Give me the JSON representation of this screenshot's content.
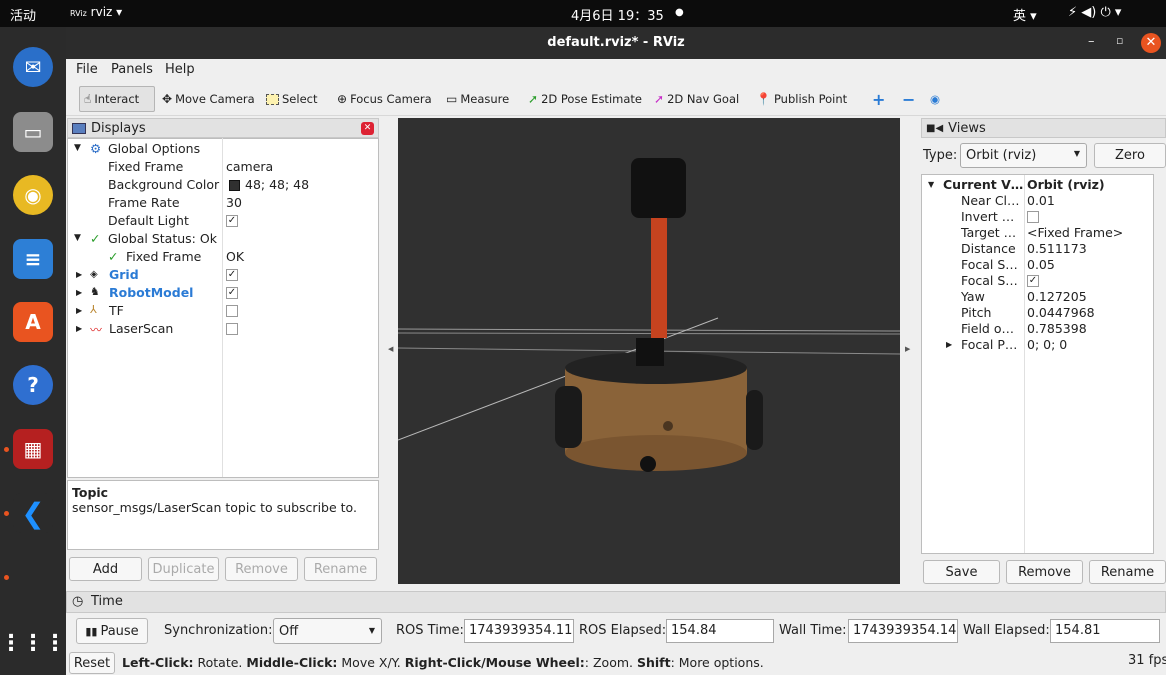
{
  "topbar": {
    "activities": "活动",
    "app": "rviz ▾",
    "clock": "4月6日 19：35",
    "clock_dot": "●",
    "ime": "英 ▾",
    "tray": "⚡ ◀) ⏻ ▾"
  },
  "window": {
    "title": "default.rviz* - RViz"
  },
  "menu": [
    "File",
    "Panels",
    "Help"
  ],
  "toolbar": {
    "interact": "Interact",
    "move_camera": "Move Camera",
    "select": "Select",
    "focus_camera": "Focus Camera",
    "measure": "Measure",
    "pose_estimate": "2D Pose Estimate",
    "nav_goal": "2D Nav Goal",
    "publish_point": "Publish Point",
    "plus": "+",
    "minus": "−",
    "eye": "◉"
  },
  "displays": {
    "title": "Displays",
    "rows": [
      {
        "name": "Global Options",
        "value": ""
      },
      {
        "name": "Fixed Frame",
        "value": "camera"
      },
      {
        "name": "Background Color",
        "value": "48; 48; 48"
      },
      {
        "name": "Frame Rate",
        "value": "30"
      },
      {
        "name": "Default Light",
        "value": "✓"
      },
      {
        "name": "Global Status: Ok",
        "value": ""
      },
      {
        "name": "Fixed Frame",
        "value": "OK"
      },
      {
        "name": "Grid",
        "value": "✓"
      },
      {
        "name": "RobotModel",
        "value": "✓"
      },
      {
        "name": "TF",
        "value": ""
      },
      {
        "name": "LaserScan",
        "value": ""
      }
    ],
    "colors": {
      "grid": "#2b7bd5",
      "robotmodel": "#2b7bd5",
      "bg_swatch": "#303030"
    }
  },
  "topic": {
    "heading": "Topic",
    "description": "sensor_msgs/LaserScan topic to subscribe to."
  },
  "display_buttons": {
    "add": "Add",
    "duplicate": "Duplicate",
    "remove": "Remove",
    "rename": "Rename"
  },
  "views": {
    "title": "Views",
    "type_label": "Type:",
    "type_value": "Orbit (rviz)",
    "zero": "Zero",
    "rows": [
      {
        "name": "Current V…",
        "value": "Orbit (rviz)"
      },
      {
        "name": "Near Cl…",
        "value": "0.01"
      },
      {
        "name": "Invert …",
        "value": ""
      },
      {
        "name": "Target …",
        "value": "<Fixed Frame>"
      },
      {
        "name": "Distance",
        "value": "0.511173"
      },
      {
        "name": "Focal S…",
        "value": "0.05"
      },
      {
        "name": "Focal S…",
        "value": "✓"
      },
      {
        "name": "Yaw",
        "value": "0.127205"
      },
      {
        "name": "Pitch",
        "value": "0.0447968"
      },
      {
        "name": "Field o…",
        "value": "0.785398"
      },
      {
        "name": "Focal P…",
        "value": "0; 0; 0"
      }
    ],
    "save": "Save",
    "remove": "Remove",
    "rename": "Rename"
  },
  "time": {
    "title": "Time",
    "pause": "Pause",
    "sync_label": "Synchronization:",
    "sync_value": "Off",
    "ros_time_label": "ROS Time:",
    "ros_time": "1743939354.11",
    "ros_elapsed_label": "ROS Elapsed:",
    "ros_elapsed": "154.84",
    "wall_time_label": "Wall Time:",
    "wall_time": "1743939354.14",
    "wall_elapsed_label": "Wall Elapsed:",
    "wall_elapsed": "154.81"
  },
  "status": {
    "reset": "Reset",
    "lc": "Left-Click:",
    "lc_t": " Rotate. ",
    "mc": "Middle-Click:",
    "mc_t": " Move X/Y. ",
    "rc": "Right-Click/Mouse Wheel:",
    "rc_t": ": Zoom. ",
    "sh": "Shift",
    "sh_t": ": More options.",
    "fps": "31 fps"
  }
}
